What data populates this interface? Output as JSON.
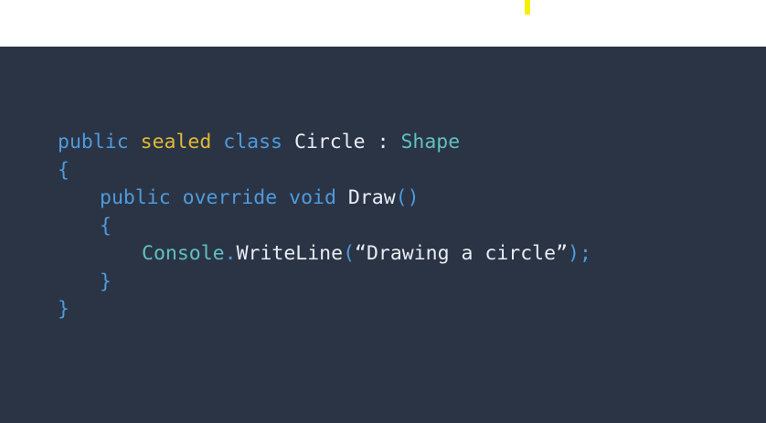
{
  "colors": {
    "background": "#2b3445",
    "top_strip": "#ffffff",
    "marker": "#f7ee00",
    "keyword": "#4e9bdd",
    "modifier": "#e3b935",
    "identifier": "#e8edf3",
    "type": "#5fc1c4",
    "punctuation": "#4e9bdd",
    "string": "#e8edf3"
  },
  "code": {
    "lines": [
      {
        "indent": 0,
        "tokens": [
          {
            "text": "public",
            "kind": "keyword"
          },
          {
            "text": " ",
            "kind": "space"
          },
          {
            "text": "sealed",
            "kind": "modifier"
          },
          {
            "text": " ",
            "kind": "space"
          },
          {
            "text": "class",
            "kind": "keyword"
          },
          {
            "text": " ",
            "kind": "space"
          },
          {
            "text": "Circle",
            "kind": "identifier"
          },
          {
            "text": " ",
            "kind": "space"
          },
          {
            "text": ":",
            "kind": "identifier"
          },
          {
            "text": " ",
            "kind": "space"
          },
          {
            "text": "Shape",
            "kind": "type"
          }
        ]
      },
      {
        "indent": 0,
        "tokens": [
          {
            "text": "{",
            "kind": "punctuation"
          }
        ]
      },
      {
        "indent": 1,
        "tokens": [
          {
            "text": "public",
            "kind": "keyword"
          },
          {
            "text": " ",
            "kind": "space"
          },
          {
            "text": "override",
            "kind": "keyword"
          },
          {
            "text": " ",
            "kind": "space"
          },
          {
            "text": "void",
            "kind": "keyword"
          },
          {
            "text": " ",
            "kind": "space"
          },
          {
            "text": "Draw",
            "kind": "identifier"
          },
          {
            "text": "()",
            "kind": "punctuation"
          }
        ]
      },
      {
        "indent": 1,
        "tokens": [
          {
            "text": "{",
            "kind": "punctuation"
          }
        ]
      },
      {
        "indent": 2,
        "tokens": [
          {
            "text": "Console",
            "kind": "type"
          },
          {
            "text": ".",
            "kind": "punctuation"
          },
          {
            "text": "WriteLine",
            "kind": "identifier"
          },
          {
            "text": "(",
            "kind": "punctuation"
          },
          {
            "text": "“Drawing a circle”",
            "kind": "string"
          },
          {
            "text": ");",
            "kind": "punctuation"
          }
        ]
      },
      {
        "indent": 1,
        "tokens": [
          {
            "text": "}",
            "kind": "punctuation"
          }
        ]
      },
      {
        "indent": 0,
        "tokens": [
          {
            "text": "}",
            "kind": "punctuation"
          }
        ]
      }
    ]
  }
}
